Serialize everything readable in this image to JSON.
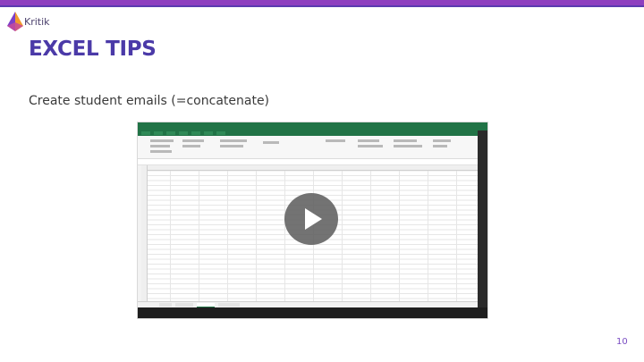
{
  "brand": {
    "name": "Kritik"
  },
  "slide": {
    "title": "EXCEL TIPS",
    "subtitle": "Create student emails (=concatenate)",
    "page_number": "10"
  },
  "colors": {
    "accent": "#8e3fbf",
    "title": "#4b3aa8",
    "excel_green": "#217346"
  },
  "video": {
    "play_icon": "play-icon"
  }
}
